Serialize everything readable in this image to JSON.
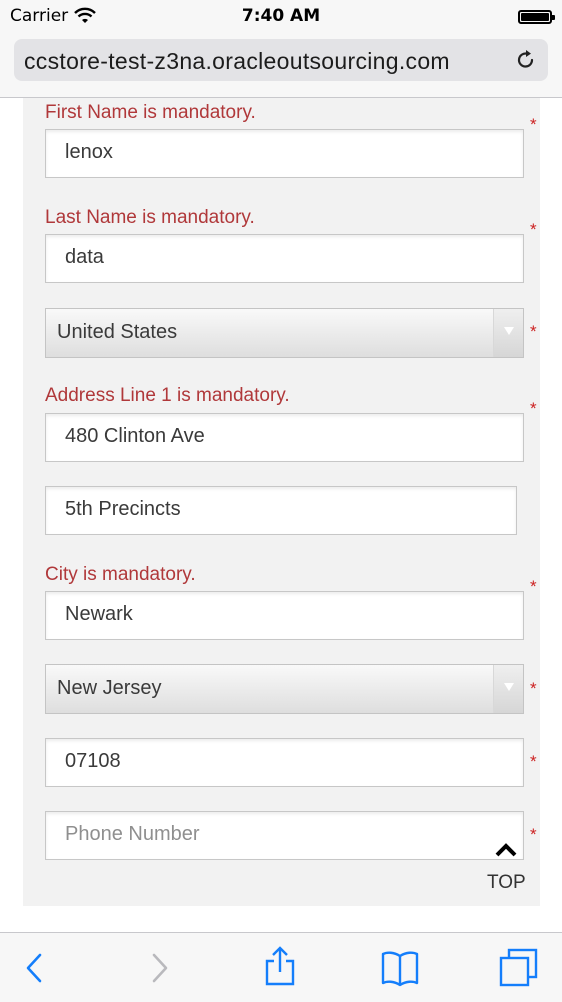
{
  "status_bar": {
    "carrier": "Carrier",
    "time": "7:40 AM",
    "wifi_icon": "wifi-icon",
    "battery_icon": "battery-icon"
  },
  "browser": {
    "url": "ccstore-test-z3na.oracleoutsourcing.com",
    "reload_icon": "reload-icon"
  },
  "form": {
    "first_name": {
      "error": "First Name is mandatory.",
      "value": "lenox",
      "required_mark": "*"
    },
    "last_name": {
      "error": "Last Name is mandatory.",
      "value": "data",
      "required_mark": "*"
    },
    "country": {
      "value": "United States",
      "required_mark": "*"
    },
    "address1": {
      "error": "Address Line 1 is mandatory.",
      "value": "480 Clinton Ave",
      "required_mark": "*"
    },
    "address2": {
      "value": "5th Precincts"
    },
    "city": {
      "error": "City is mandatory.",
      "value": "Newark",
      "required_mark": "*"
    },
    "state": {
      "value": "New Jersey",
      "required_mark": "*"
    },
    "zip": {
      "value": "07108",
      "required_mark": "*"
    },
    "phone": {
      "placeholder": "Phone Number",
      "required_mark": "*"
    }
  },
  "top_button": {
    "label": "TOP"
  },
  "toolbar": {
    "icons": [
      "back-icon",
      "forward-icon",
      "share-icon",
      "bookmarks-icon",
      "tabs-icon"
    ]
  },
  "colors": {
    "error": "#b0383a",
    "required": "#cc2222",
    "ios_blue": "#147efb"
  }
}
